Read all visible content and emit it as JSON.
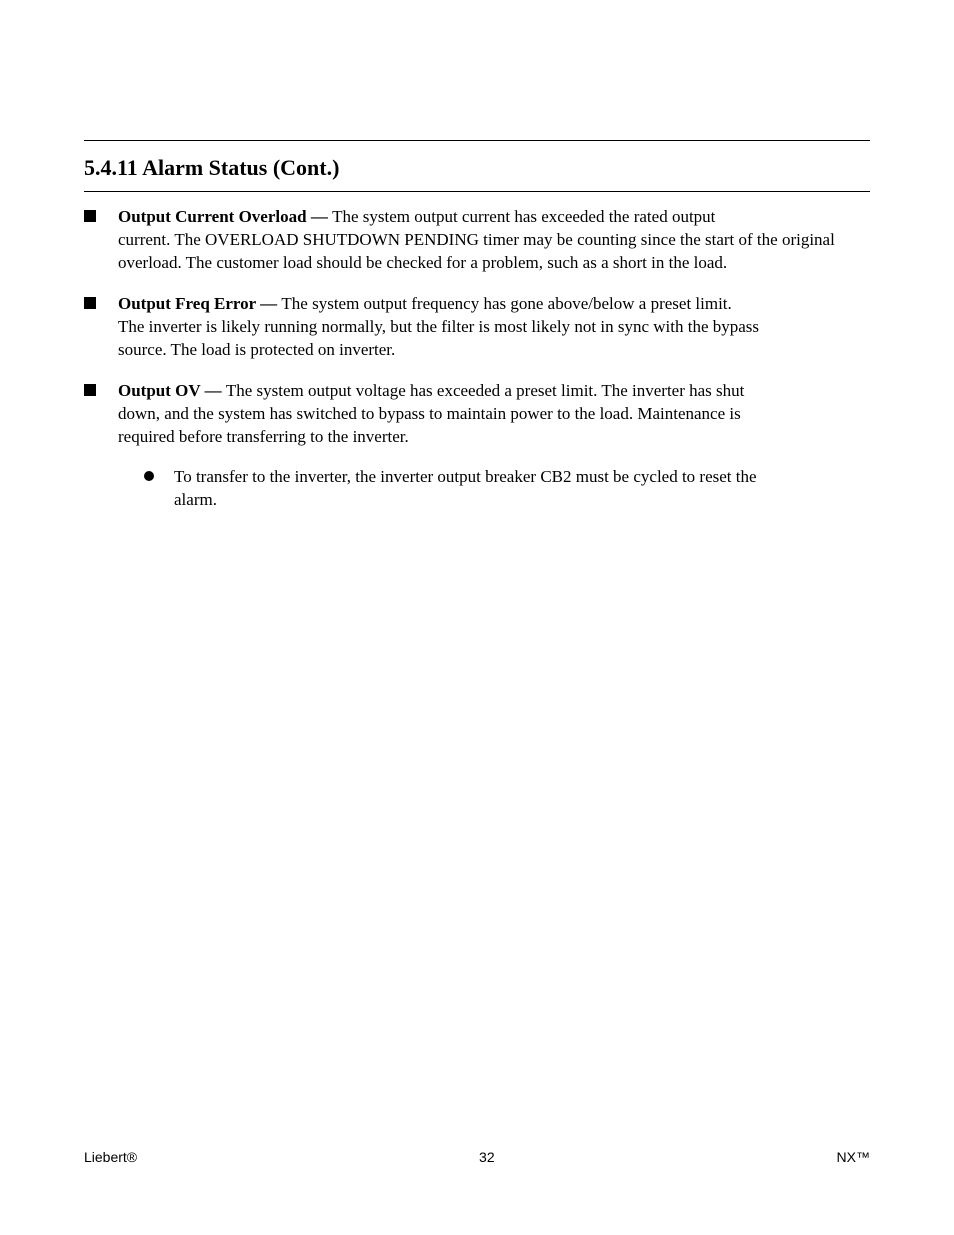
{
  "section_title": "5.4.11  Alarm Status (Cont.)",
  "items": [
    {
      "level": 1,
      "bullet": "square",
      "head": "Output Current Overload — ",
      "inline": "The system output current has exceeded the rated output",
      "desc_lines": [
        "current. The OVERLOAD SHUTDOWN PENDING timer may be counting since the start of the original",
        "overload. The customer load should be checked for a problem, such as a short in the load."
      ]
    },
    {
      "level": 1,
      "bullet": "square",
      "head": "Output Freq Error — ",
      "inline": "The system output frequency has gone above/below a preset limit.",
      "desc_lines": [
        "The inverter is likely running normally, but the filter is most likely not in sync with the bypass",
        "source. The load is protected on inverter."
      ]
    },
    {
      "level": 1,
      "bullet": "square",
      "head": "Output OV — ",
      "inline": "The system output voltage has exceeded a preset limit. The inverter has shut",
      "desc_lines": [
        "down, and the system has switched to bypass to maintain power to the load. Maintenance is",
        "required before transferring to the inverter."
      ]
    },
    {
      "level": 2,
      "bullet": "round",
      "head": null,
      "inline": null,
      "desc_lines": [
        "To transfer to the inverter, the inverter output breaker CB2 must be cycled to reset the",
        "alarm."
      ]
    }
  ],
  "footer": {
    "left": "Liebert®",
    "center": "32",
    "right": "NX™"
  }
}
